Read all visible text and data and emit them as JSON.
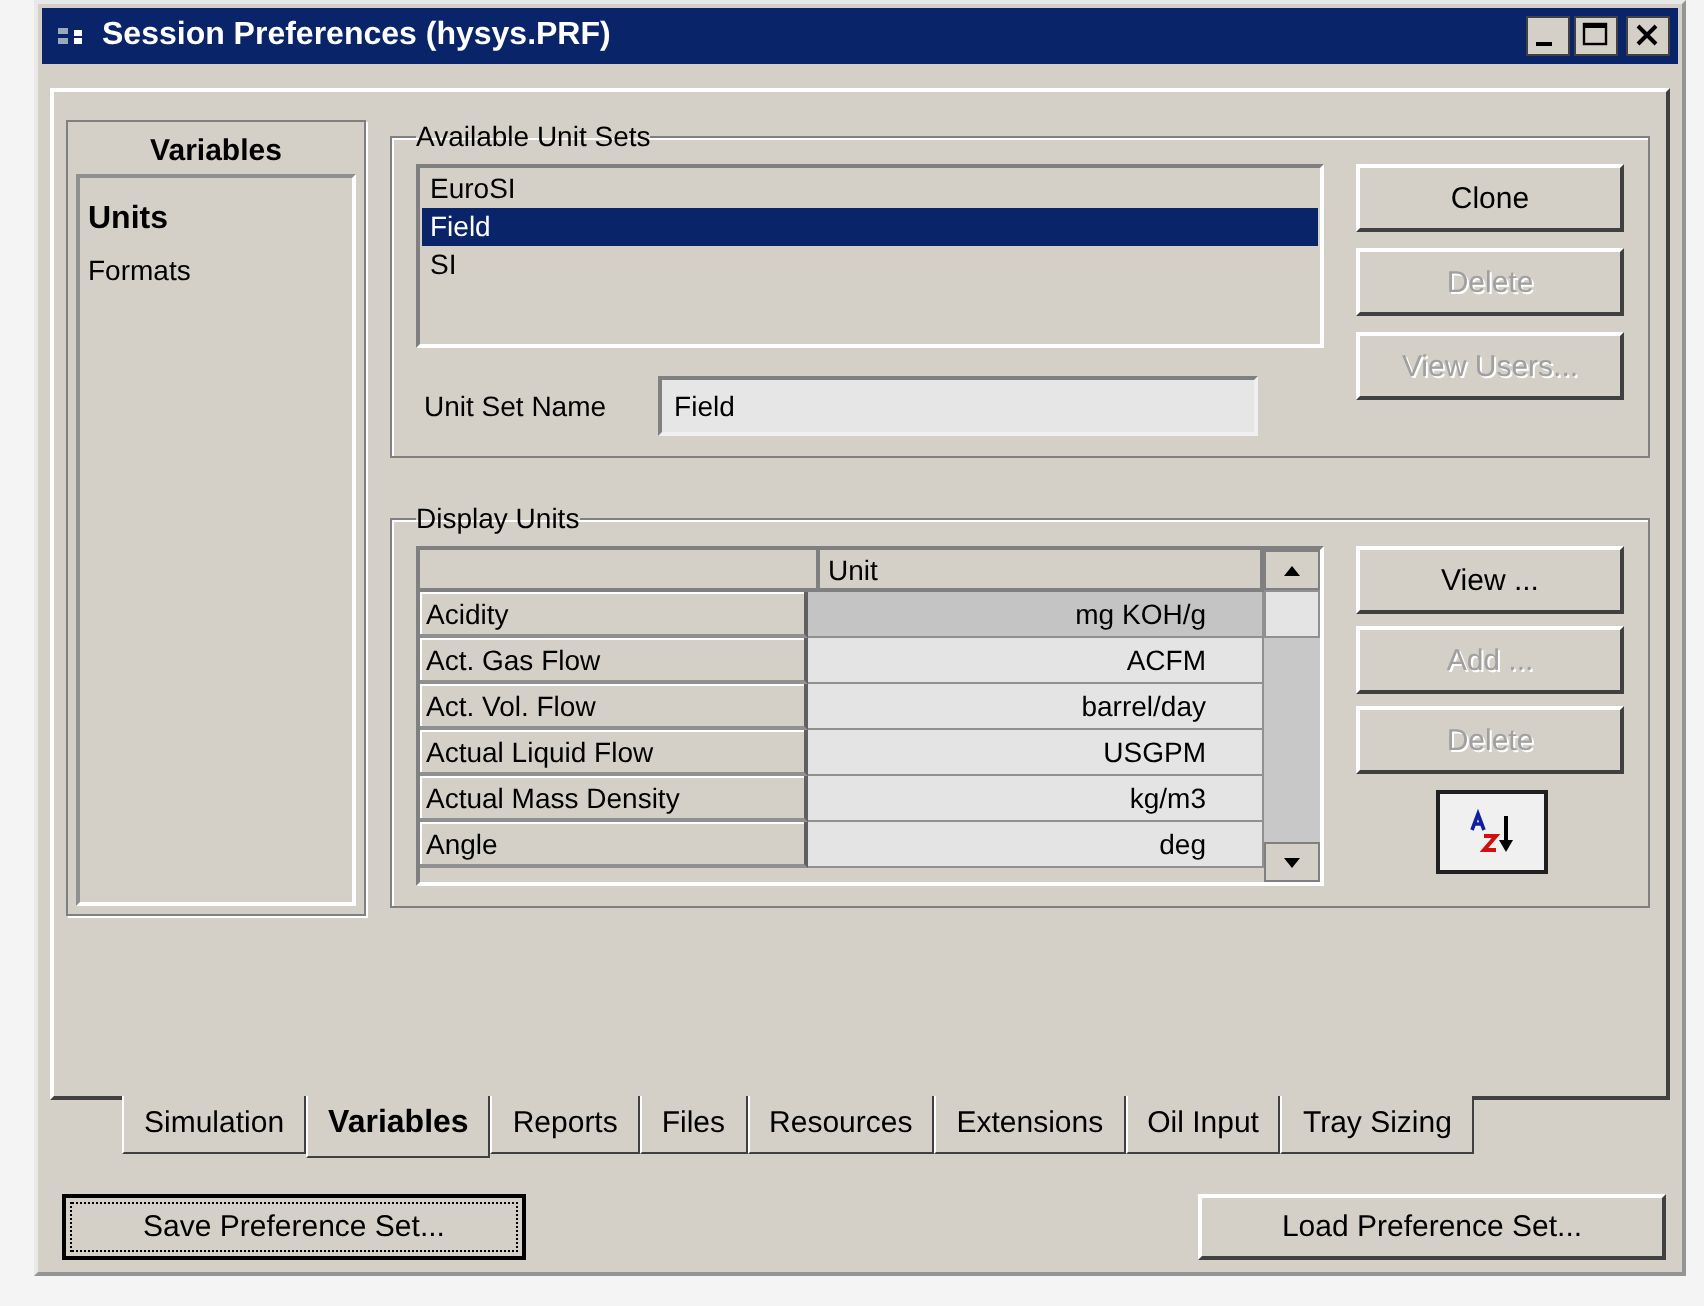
{
  "window": {
    "title": "Session Preferences (hysys.PRF)"
  },
  "sidebar": {
    "title": "Variables",
    "items": [
      {
        "label": "Units",
        "selected": true
      },
      {
        "label": "Formats",
        "selected": false
      }
    ]
  },
  "unit_sets": {
    "title": "Available Unit Sets",
    "items": [
      {
        "label": "EuroSI",
        "selected": false
      },
      {
        "label": "Field",
        "selected": true
      },
      {
        "label": "SI",
        "selected": false
      }
    ],
    "name_label": "Unit Set Name",
    "name_value": "Field",
    "buttons": [
      {
        "label": "Clone",
        "disabled": false
      },
      {
        "label": "Delete",
        "disabled": true
      },
      {
        "label": "View Users...",
        "disabled": true
      }
    ]
  },
  "display_units": {
    "title": "Display Units",
    "columns": [
      "Unit"
    ],
    "rows": [
      {
        "variable": "Acidity",
        "unit": "mg KOH/g",
        "selected": true
      },
      {
        "variable": "Act. Gas Flow",
        "unit": "ACFM",
        "selected": false
      },
      {
        "variable": "Act. Vol. Flow",
        "unit": "barrel/day",
        "selected": false
      },
      {
        "variable": "Actual Liquid Flow",
        "unit": "USGPM",
        "selected": false
      },
      {
        "variable": "Actual Mass Density",
        "unit": "kg/m3",
        "selected": false
      },
      {
        "variable": "Angle",
        "unit": "deg",
        "selected": false
      }
    ],
    "buttons": [
      {
        "label": "View ...",
        "disabled": false
      },
      {
        "label": "Add ...",
        "disabled": true
      },
      {
        "label": "Delete",
        "disabled": true
      }
    ]
  },
  "tabs": [
    {
      "label": "Simulation",
      "selected": false
    },
    {
      "label": "Variables",
      "selected": true
    },
    {
      "label": "Reports",
      "selected": false
    },
    {
      "label": "Files",
      "selected": false
    },
    {
      "label": "Resources",
      "selected": false
    },
    {
      "label": "Extensions",
      "selected": false
    },
    {
      "label": "Oil Input",
      "selected": false
    },
    {
      "label": "Tray Sizing",
      "selected": false
    }
  ],
  "footer_buttons": [
    {
      "label": "Save Preference Set...",
      "focused": true
    },
    {
      "label": "Load Preference Set...",
      "focused": false
    }
  ]
}
